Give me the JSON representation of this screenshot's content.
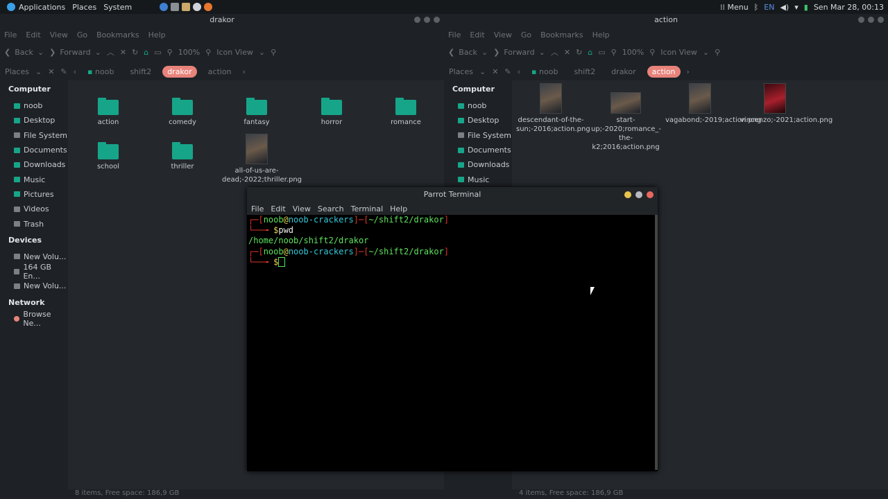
{
  "topbar": {
    "applications": "Applications",
    "places": "Places",
    "system": "System",
    "menu": "Menu",
    "lang": "EN",
    "datetime": "Sen Mar 28, 00:13"
  },
  "left": {
    "title": "drakor",
    "menu": [
      "File",
      "Edit",
      "View",
      "Go",
      "Bookmarks",
      "Help"
    ],
    "toolbar": {
      "back": "Back",
      "forward": "Forward",
      "zoom": "100%",
      "view": "Icon View"
    },
    "places": "Places",
    "crumbs": [
      "noob",
      "shift2",
      "drakor",
      "action"
    ],
    "sidebar": {
      "computer": "Computer",
      "items": [
        "noob",
        "Desktop",
        "File System",
        "Documents",
        "Downloads",
        "Music",
        "Pictures",
        "Videos",
        "Trash"
      ],
      "devices": "Devices",
      "devitems": [
        "New Volu...",
        "164 GB En...",
        "New Volu..."
      ],
      "network": "Network",
      "netitems": [
        "Browse Ne..."
      ]
    },
    "files": [
      "action",
      "comedy",
      "fantasy",
      "horror",
      "romance",
      "school",
      "thriller",
      "all-of-us-are-dead;-2022;thriller.png"
    ],
    "status": "8 items, Free space: 186,9 GB"
  },
  "right": {
    "title": "action",
    "menu": [
      "File",
      "Edit",
      "View",
      "Go",
      "Bookmarks",
      "Help"
    ],
    "toolbar": {
      "back": "Back",
      "forward": "Forward",
      "zoom": "100%",
      "view": "Icon View"
    },
    "places": "Places",
    "crumbs": [
      "noob",
      "shift2",
      "drakor",
      "action"
    ],
    "sidebar": {
      "computer": "Computer",
      "items": [
        "noob",
        "Desktop",
        "File System",
        "Documents",
        "Downloads",
        "Music"
      ]
    },
    "files": [
      "descendant-of-the-sun;-2016;action.png",
      "start-up;-2020;romance_-the-k2;2016;action.png",
      "vagabond;-2019;action.png",
      "vincenzo;-2021;action.png"
    ],
    "status": "4 items, Free space: 186,9 GB"
  },
  "terminal": {
    "title": "Parrot Terminal",
    "menu": [
      "File",
      "Edit",
      "View",
      "Search",
      "Terminal",
      "Help"
    ],
    "user": "noob",
    "host": "noob-crackers",
    "path": "~/shift2/drakor",
    "cmd": "pwd",
    "output": "/home/noob/shift2/drakor"
  }
}
